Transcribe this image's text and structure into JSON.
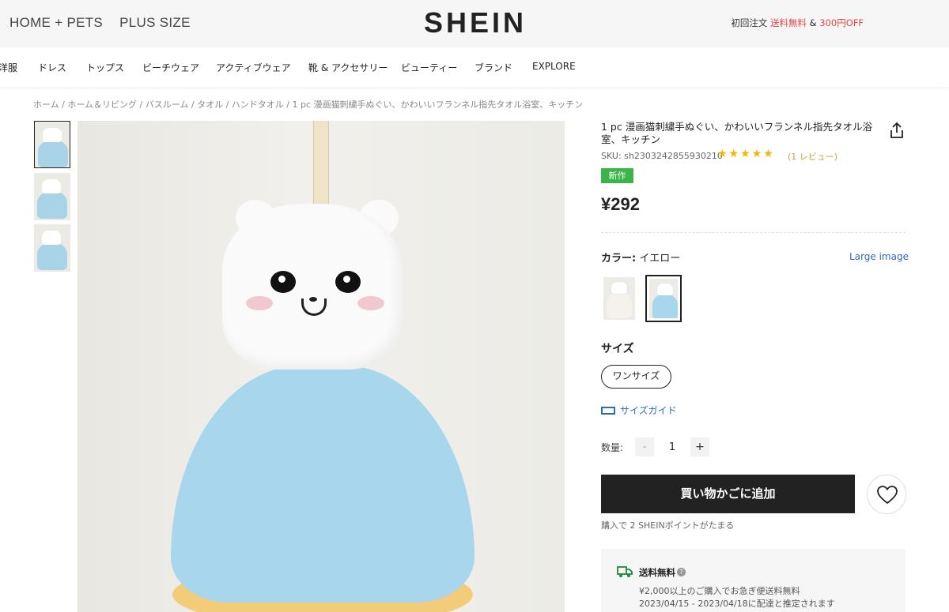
{
  "header": {
    "nav_left": [
      "HOME + PETS",
      "PLUS SIZE"
    ],
    "logo": "SHEIN",
    "promo_prefix": "初回注文",
    "promo_free": "送料無料",
    "promo_amp": "&",
    "promo_off": "300円OFF"
  },
  "category_nav": [
    "洋服",
    "ドレス",
    "トップス",
    "ビーチウェア",
    "アクティブウェア",
    "靴 & アクセサリー",
    "ビューティー",
    "ブランド",
    "EXPLORE"
  ],
  "breadcrumb": "ホーム / ホーム＆リビング / バスルーム / タオル / ハンドタオル / 1 pc 漫画猫刺繍手ぬぐい、かわいいフランネル指先タオル浴室、キッチン",
  "product": {
    "title": "1 pc 漫画猫刺繍手ぬぐい、かわいいフランネル指先タオル浴室、キッチン",
    "sku": "SKU: sh2303242855930210",
    "stars": "★★★★★",
    "reviews": "(1 レビュー)",
    "badge": "新作",
    "price": "¥292",
    "color_label": "カラー:",
    "color_value": "イエロー",
    "large_image": "Large image",
    "size_label": "サイズ",
    "size_option": "ワンサイズ",
    "size_guide": "サイズガイド",
    "qty_label": "数量:",
    "qty_value": "1",
    "qty_minus": "-",
    "qty_plus": "+",
    "add_to_cart": "買い物かごに追加",
    "points_note": "購入で 2 SHEINポイントがたまる"
  },
  "shipping": {
    "title": "送料無料",
    "help": "?",
    "line1": "¥2,000以上のご購入でお急ぎ便送料無料",
    "line2": "2023/04/15 - 2023/04/18に配達と推定されます"
  },
  "colors": {
    "accent_green": "#3bb54a",
    "star_yellow": "#f7b500",
    "link_blue": "#2d6cb5",
    "promo_red": "#e84545",
    "towel_blue": "#a8d6ec",
    "towel_rim": "#f3cc7a"
  }
}
